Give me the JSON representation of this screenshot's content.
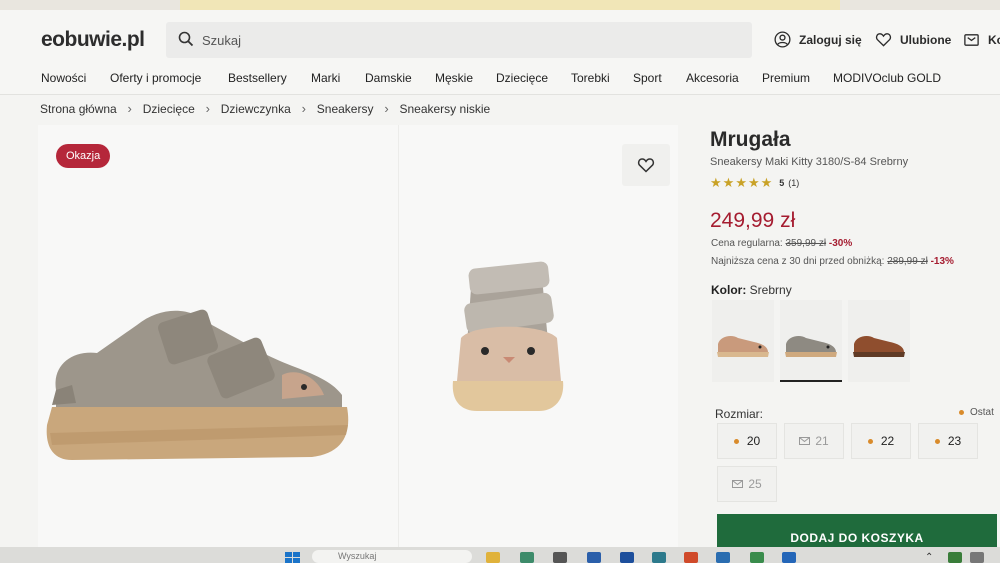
{
  "header": {
    "logo": "eobuwie",
    "logo_suffix": ".pl",
    "search_placeholder": "Szukaj",
    "login_label": "Zaloguj się",
    "favorites_label": "Ulubione",
    "cart_label": "Ko"
  },
  "nav": [
    "Nowości",
    "Oferty i promocje",
    "Bestsellery",
    "Marki",
    "Damskie",
    "Męskie",
    "Dziecięce",
    "Torebki",
    "Sport",
    "Akcesoria",
    "Premium",
    "MODIVOclub GOLD"
  ],
  "breadcrumb": [
    "Strona główna",
    "Dziecięce",
    "Dziewczynka",
    "Sneakersy",
    "Sneakersy niskie"
  ],
  "gallery": {
    "badge": "Okazja"
  },
  "product": {
    "brand": "Mrugała",
    "name": "Sneakersy Maki Kitty 3180/S-84 Srebrny",
    "rating_score": "5",
    "rating_count": "(1)",
    "rating_stars": 5,
    "price": "249,99 zł",
    "regular_label": "Cena regularna:",
    "regular_price": "359,99 zł",
    "regular_discount": "-30%",
    "lowest_label": "Najniższa cena z 30 dni przed obniżką:",
    "lowest_price": "289,99 zł",
    "lowest_discount": "-13%",
    "color_label": "Kolor:",
    "color_value": "Srebrny",
    "size_label": "Rozmiar:",
    "stock_note": "Ostat",
    "sizes": [
      {
        "label": "20",
        "status": "available"
      },
      {
        "label": "21",
        "status": "notify"
      },
      {
        "label": "22",
        "status": "available"
      },
      {
        "label": "23",
        "status": "available"
      },
      {
        "label": "25",
        "status": "notify"
      }
    ],
    "add_to_cart": "DODAJ DO KOSZYKA"
  },
  "taskbar": {
    "search_text": "Wyszukaj"
  },
  "colors": {
    "accent_red": "#a51c30",
    "badge_red": "#b5273a",
    "cart_green": "#1f6b3c",
    "stock_orange": "#d98b2b",
    "star_gold": "#c9a227"
  }
}
